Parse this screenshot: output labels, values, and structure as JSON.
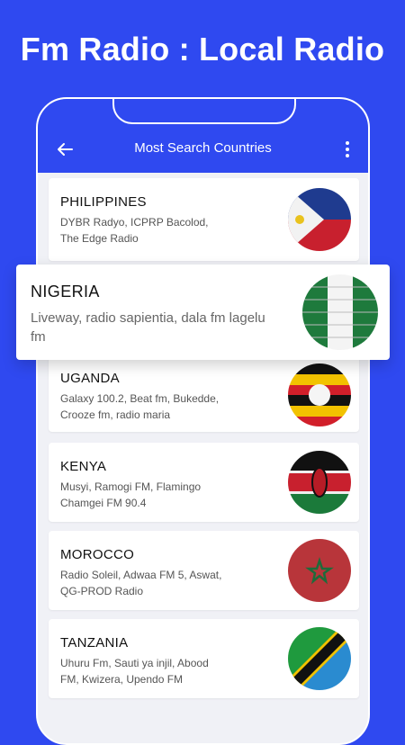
{
  "headline": "Fm Radio : Local Radio",
  "appbar": {
    "title": "Most Search Countries",
    "back_icon": "arrow-left-icon",
    "menu_icon": "more-vertical-icon"
  },
  "countries": [
    {
      "name": "PHILIPPINES",
      "stations": "DYBR Radyo, ICPRP Bacolod, The Edge Radio",
      "flag": "philippines-flag-icon"
    },
    {
      "name": "UGANDA",
      "stations": "Galaxy 100.2, Beat fm, Bukedde, Crooze fm, radio maria",
      "flag": "uganda-flag-icon"
    },
    {
      "name": "KENYA",
      "stations": "Musyi, Ramogi FM, Flamingo Chamgei FM 90.4",
      "flag": "kenya-flag-icon"
    },
    {
      "name": "MOROCCO",
      "stations": "Radio Soleil, Adwaa FM 5, Aswat, QG-PROD Radio",
      "flag": "morocco-flag-icon"
    },
    {
      "name": "TANZANIA",
      "stations": "Uhuru Fm, Sauti ya injil, Abood FM, Kwizera, Upendo FM",
      "flag": "tanzania-flag-icon"
    }
  ],
  "highlighted": {
    "name": "NIGERIA",
    "stations": "Liveway, radio sapientia, dala fm lagelu fm",
    "flag": "nigeria-flag-icon"
  },
  "colors": {
    "primary": "#2f49f0",
    "background": "#f0f1f6",
    "card": "#ffffff"
  }
}
